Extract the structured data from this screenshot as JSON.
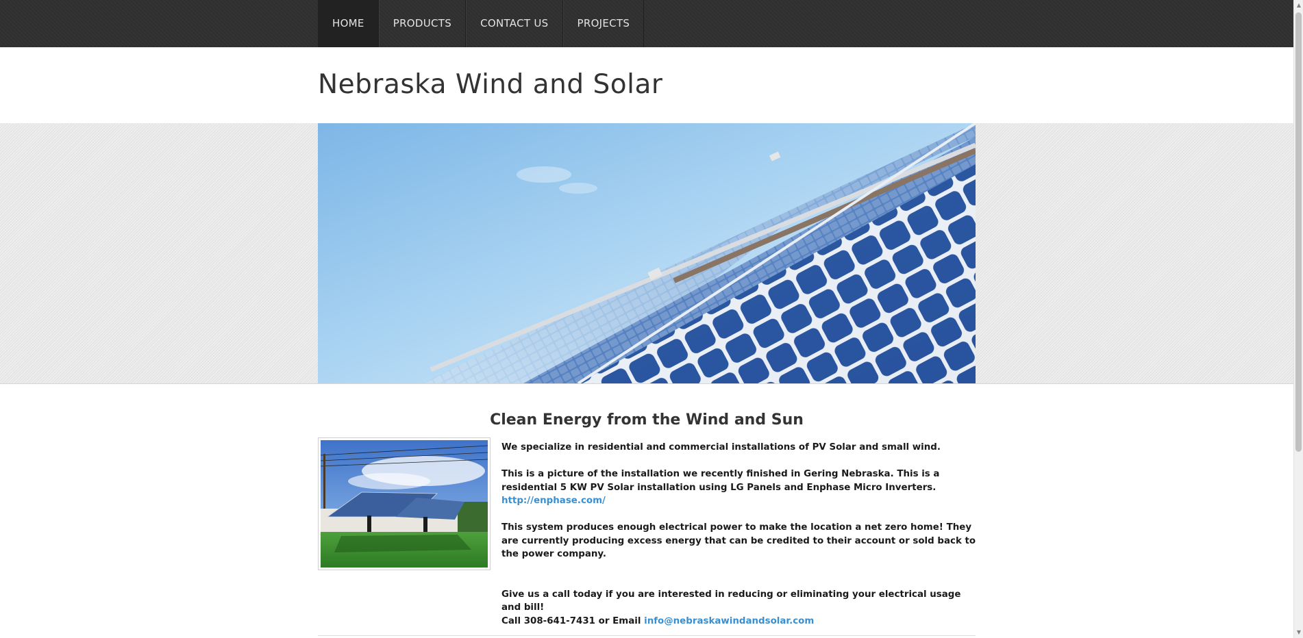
{
  "nav": {
    "items": [
      {
        "label": "HOME",
        "active": true
      },
      {
        "label": "PRODUCTS",
        "active": false
      },
      {
        "label": "CONTACT US",
        "active": false
      },
      {
        "label": "PROJECTS",
        "active": false
      }
    ]
  },
  "header": {
    "site_title": "Nebraska Wind and Solar"
  },
  "main": {
    "heading": "Clean Energy from the Wind and Sun",
    "p1": "We specialize in residential and commercial installations of PV Solar and small wind.",
    "p2": "This is a picture of the installation we recently finished in Gering Nebraska.  This is a residential 5 KW PV Solar installation using LG Panels and Enphase Micro Inverters.",
    "p2_link": "http://enphase.com/",
    "p3": "This system produces enough electrical power to make the location a net zero home!  They are currently producing excess energy that can be credited to their account or sold back to the power company.",
    "p4": "Give us a call today if you are interested in reducing or eliminating your electrical usage and bill!",
    "p5_prefix": "Call 308-641-7431 or Email",
    "p5_email": "info@nebraskawindandsolar.com"
  },
  "images": {
    "banner": "solar-panels-sky-banner",
    "photo": "ground-mount-solar-array-photo"
  },
  "colors": {
    "nav_bg": "#303030",
    "nav_active": "#222222",
    "link": "#3a8fd0",
    "title": "#333333",
    "banner_band": "#e9e9e9"
  }
}
